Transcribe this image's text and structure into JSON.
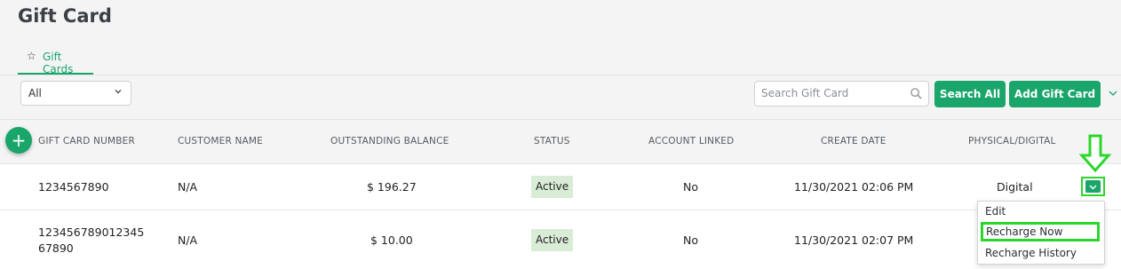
{
  "page": {
    "title": "Gift Card"
  },
  "tabs": [
    {
      "label": "Gift Cards",
      "icon": "star-icon"
    }
  ],
  "filter": {
    "selected": "All"
  },
  "search": {
    "placeholder": "Search Gift Card"
  },
  "toolbar": {
    "search_all": "Search All",
    "add_gift_card": "Add Gift Card"
  },
  "table": {
    "columns": [
      "GIFT CARD NUMBER",
      "CUSTOMER NAME",
      "OUTSTANDING BALANCE",
      "STATUS",
      "ACCOUNT LINKED",
      "CREATE DATE",
      "PHYSICAL/DIGITAL"
    ],
    "rows": [
      {
        "number": "1234567890",
        "customer": "N/A",
        "balance": "$ 196.27",
        "status": "Active",
        "linked": "No",
        "created": "11/30/2021 02:06 PM",
        "type": "Digital"
      },
      {
        "number_line1": "123456789012345",
        "number_line2": "67890",
        "customer": "N/A",
        "balance": "$ 10.00",
        "status": "Active",
        "linked": "No",
        "created": "11/30/2021 02:07 PM",
        "type": ""
      }
    ]
  },
  "row_menu": {
    "items": [
      "Edit",
      "Recharge Now",
      "Recharge History"
    ]
  },
  "colors": {
    "accent": "#1aa56b",
    "highlight": "#2bd62b",
    "badge_bg": "#d9ecd6"
  }
}
